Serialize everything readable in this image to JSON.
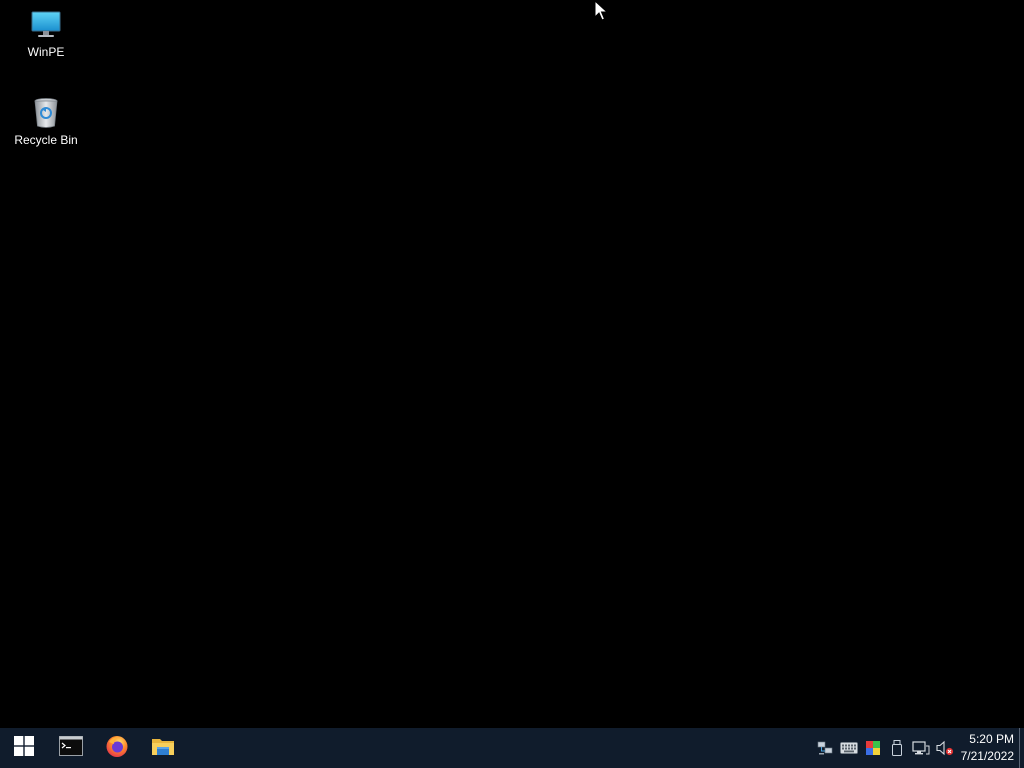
{
  "desktop": {
    "icons": [
      {
        "label": "WinPE",
        "icon": "computer-icon"
      },
      {
        "label": "Recycle Bin",
        "icon": "recycle-bin-icon"
      }
    ]
  },
  "taskbar": {
    "pinned": [
      {
        "icon": "windows-start-icon"
      },
      {
        "icon": "command-prompt-icon"
      },
      {
        "icon": "firefox-icon"
      },
      {
        "icon": "file-explorer-icon"
      }
    ],
    "tray": [
      {
        "icon": "network-share-icon"
      },
      {
        "icon": "keyboard-icon"
      },
      {
        "icon": "color-palette-icon"
      },
      {
        "icon": "usb-drive-icon"
      },
      {
        "icon": "network-icon"
      },
      {
        "icon": "volume-muted-icon"
      }
    ],
    "clock": {
      "time": "5:20 PM",
      "date": "7/21/2022"
    }
  },
  "colors": {
    "desktop_background": "#000000",
    "taskbar_background": "#101c2c",
    "text": "#ffffff"
  }
}
